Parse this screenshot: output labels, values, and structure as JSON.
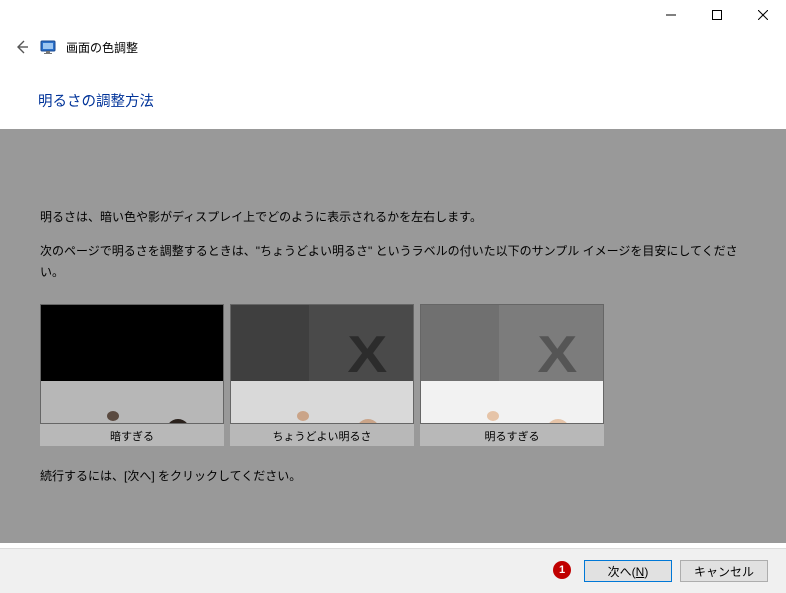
{
  "window": {
    "app_title": "画面の色調整"
  },
  "page": {
    "heading": "明るさの調整方法",
    "para1": "明るさは、暗い色や影がディスプレイ上でどのように表示されるかを左右します。",
    "para2": "次のページで明るさを調整するときは、\"ちょうどよい明るさ\" というラベルの付いた以下のサンプル イメージを目安にしてください。",
    "continue_hint": "続行するには、[次へ] をクリックしてください。"
  },
  "samples": {
    "items": [
      {
        "caption": "暗すぎる"
      },
      {
        "caption": "ちょうどよい明るさ"
      },
      {
        "caption": "明るすぎる"
      }
    ]
  },
  "footer": {
    "next_label_prefix": "次へ(",
    "next_access": "N",
    "next_label_suffix": ")",
    "cancel_label": "キャンセル"
  },
  "annotation": {
    "step1": "1"
  }
}
